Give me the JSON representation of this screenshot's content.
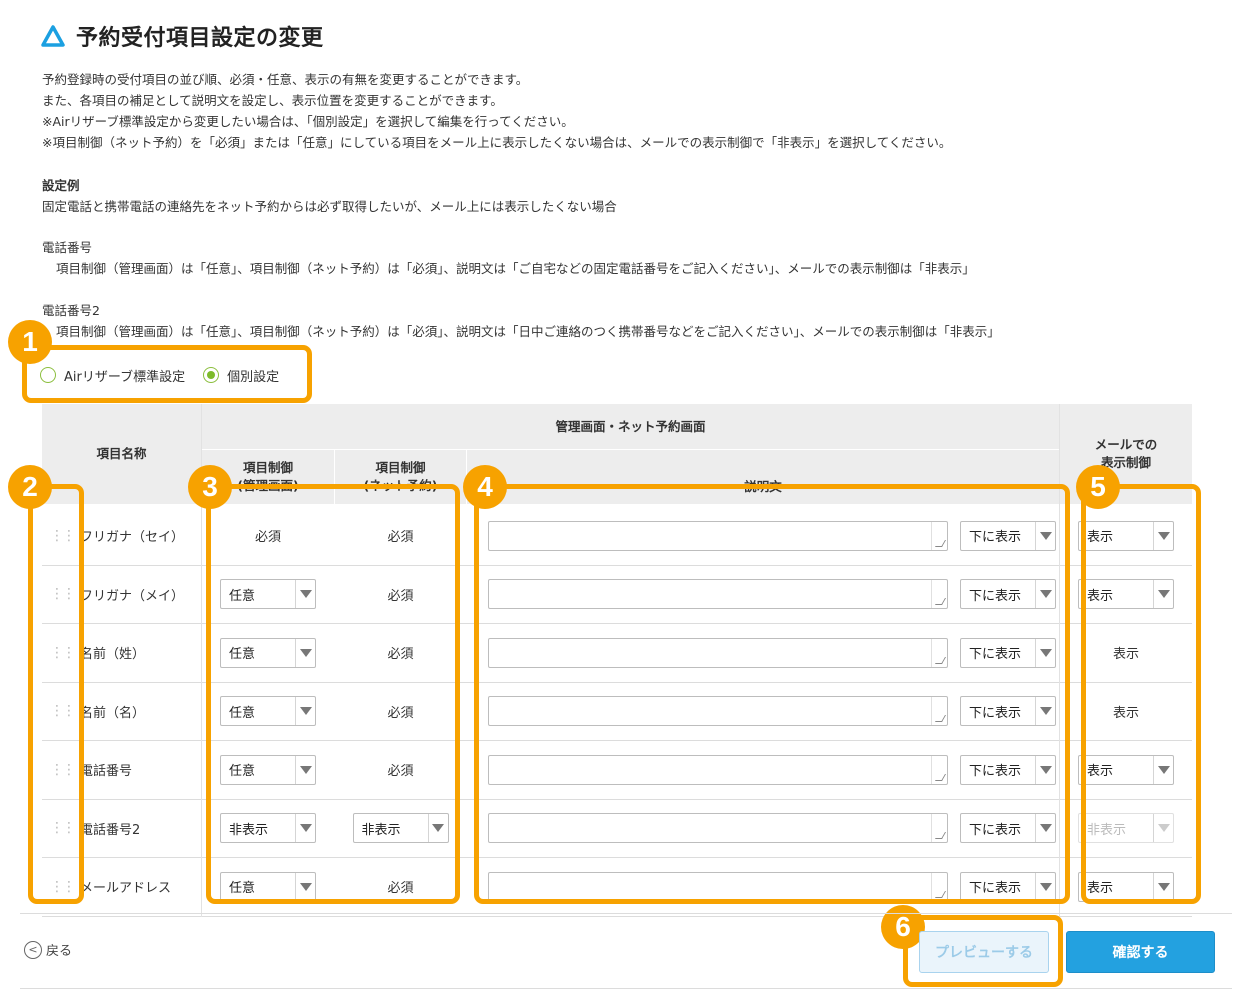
{
  "page": {
    "title": "予約受付項目設定の変更"
  },
  "description": {
    "lines": [
      "予約登録時の受付項目の並び順、必須・任意、表示の有無を変更することができます。",
      "また、各項目の補足として説明文を設定し、表示位置を変更することができます。",
      "※Airリザーブ標準設定から変更したい場合は、「個別設定」を選択して編集を行ってください。",
      "※項目制御（ネット予約）を「必須」または「任意」にしている項目をメール上に表示したくない場合は、メールでの表示制御で「非表示」を選択してください。"
    ],
    "example_heading": "設定例",
    "example_text": "固定電話と携帯電話の連絡先をネット予約からは必ず取得したいが、メール上には表示したくない場合",
    "phone_label": "電話番号",
    "phone_text": "項目制御（管理画面）は「任意」、項目制御（ネット予約）は「必須」、説明文は「ご自宅などの固定電話番号をご記入ください」、メールでの表示制御は「非表示」",
    "phone2_label": "電話番号2",
    "phone2_text": "項目制御（管理画面）は「任意」、項目制御（ネット予約）は「必須」、説明文は「日中ご連絡のつく携帯番号などをご記入ください」、メールでの表示制御は「非表示」"
  },
  "mode": {
    "options": [
      "Airリザーブ標準設定",
      "個別設定"
    ],
    "selected": "個別設定"
  },
  "table": {
    "headers": {
      "item_name": "項目名称",
      "group": "管理画面・ネット予約画面",
      "control_admin": "項目制御\n(管理画面)",
      "control_net": "項目制御\n(ネット予約)",
      "description": "説明文",
      "mail": "メールでの\n表示制御"
    },
    "rows": [
      {
        "name": "フリガナ（セイ）",
        "admin": "必須",
        "admin_select": false,
        "net": "必須",
        "net_select": false,
        "position": "下に表示",
        "mail": "表示",
        "mail_select": true,
        "mail_disabled": false
      },
      {
        "name": "フリガナ（メイ）",
        "admin": "任意",
        "admin_select": true,
        "net": "必須",
        "net_select": false,
        "position": "下に表示",
        "mail": "表示",
        "mail_select": true,
        "mail_disabled": false
      },
      {
        "name": "名前（姓）",
        "admin": "任意",
        "admin_select": true,
        "net": "必須",
        "net_select": false,
        "position": "下に表示",
        "mail": "表示",
        "mail_select": false,
        "mail_disabled": false
      },
      {
        "name": "名前（名）",
        "admin": "任意",
        "admin_select": true,
        "net": "必須",
        "net_select": false,
        "position": "下に表示",
        "mail": "表示",
        "mail_select": false,
        "mail_disabled": false
      },
      {
        "name": "電話番号",
        "admin": "任意",
        "admin_select": true,
        "net": "必須",
        "net_select": false,
        "position": "下に表示",
        "mail": "表示",
        "mail_select": true,
        "mail_disabled": false
      },
      {
        "name": "電話番号2",
        "admin": "非表示",
        "admin_select": true,
        "net": "非表示",
        "net_select": true,
        "position": "下に表示",
        "mail": "非表示",
        "mail_select": true,
        "mail_disabled": true
      },
      {
        "name": "メールアドレス",
        "admin": "任意",
        "admin_select": true,
        "net": "必須",
        "net_select": false,
        "position": "下に表示",
        "mail": "表示",
        "mail_select": true,
        "mail_disabled": false
      }
    ]
  },
  "callouts": [
    "1",
    "2",
    "3",
    "4",
    "5",
    "6"
  ],
  "footer": {
    "back_label": "戻る",
    "back_icon": "chevron-left-icon",
    "preview_label": "プレビューする",
    "confirm_label": "確認する"
  },
  "colors": {
    "accent": "#f7a200",
    "primary_button": "#23a1e0",
    "radio_green": "#7dbb2a",
    "logo_blue": "#1ba0e1"
  }
}
